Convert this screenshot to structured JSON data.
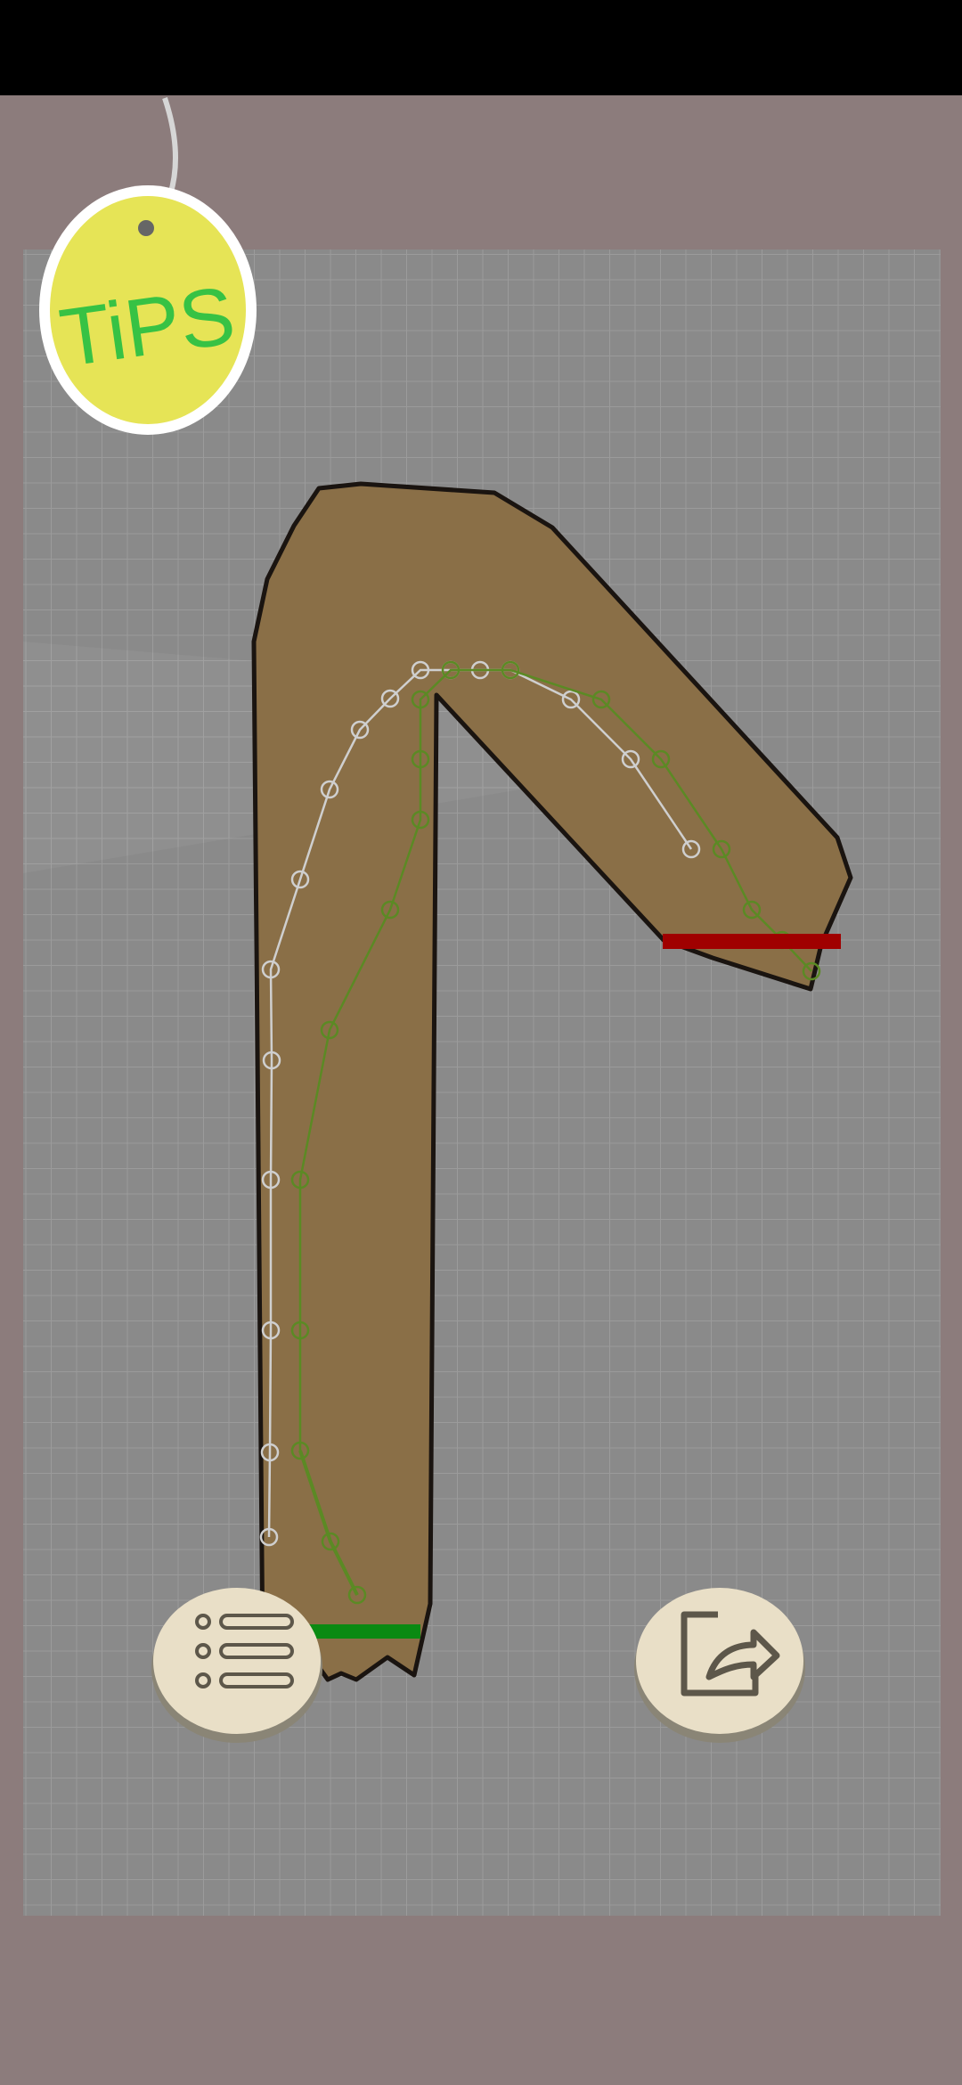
{
  "tips_tag": {
    "label": "TiPS",
    "color": "#e6e456",
    "text_color": "#37c244"
  },
  "paper": {
    "color": "#8a8a8a",
    "grid_color": "#9a9a9a"
  },
  "stroke_guide": {
    "shape_color": "#8a6f47",
    "start_marker_color": "#0a8a12",
    "end_marker_color": "#a00000",
    "path_colors": {
      "green": "#5b8a24",
      "gray": "#cfcfcf"
    }
  },
  "buttons": {
    "menu": {
      "icon": "list-icon"
    },
    "exit": {
      "icon": "exit-icon"
    }
  }
}
